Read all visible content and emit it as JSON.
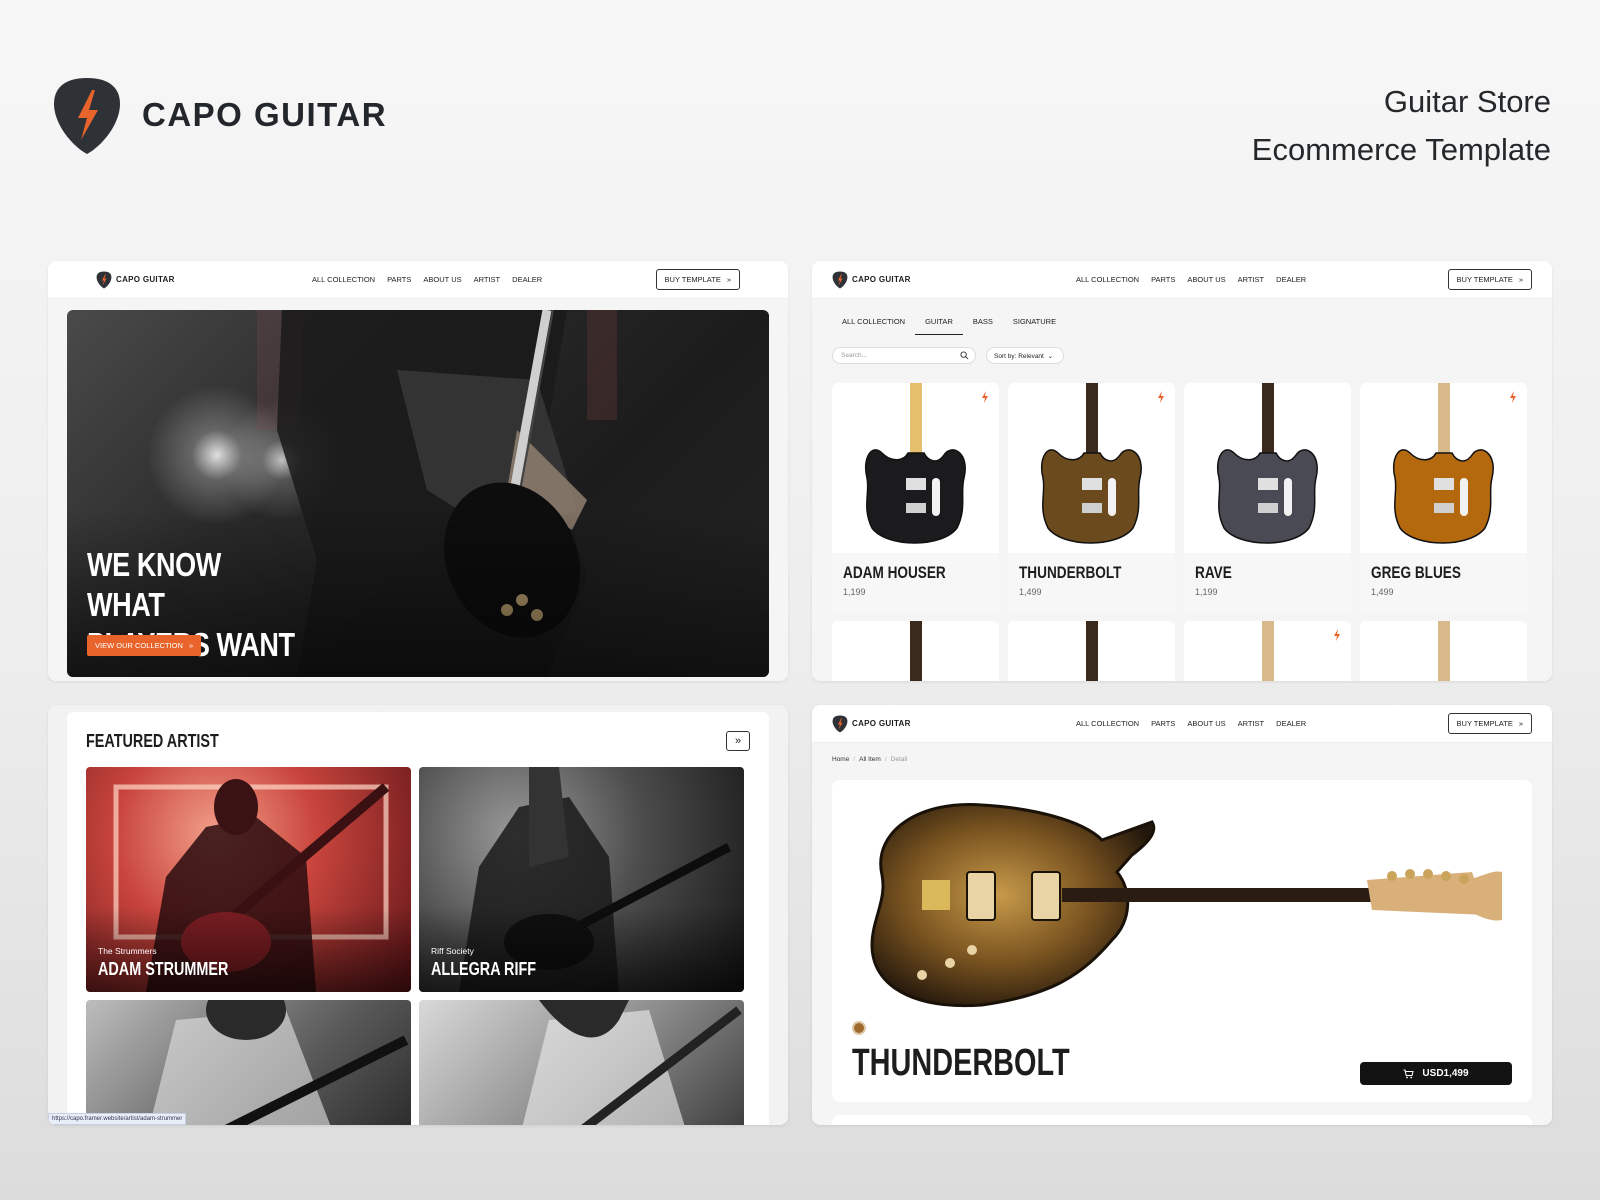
{
  "brand": {
    "name": "CAPO GUITAR",
    "tagline_1": "Guitar Store",
    "tagline_2": "Ecommerce Template"
  },
  "colors": {
    "accent": "#e8642b",
    "dark": "#2e3237",
    "text": "#1d1d1d"
  },
  "nav": {
    "brand": "CAPO GUITAR",
    "links": [
      "ALL COLLECTION",
      "PARTS",
      "ABOUT US",
      "ARTIST",
      "DEALER"
    ],
    "buy_label": "BUY TEMPLATE"
  },
  "hero": {
    "title": "WE KNOW WHAT\nPLAYERS WANT",
    "cta": "VIEW OUR COLLECTION"
  },
  "collection": {
    "tabs": [
      "ALL COLLECTION",
      "GUITAR",
      "BASS",
      "SIGNATURE"
    ],
    "active_tab": "GUITAR",
    "search_placeholder": "Search...",
    "sort_label": "Sort by: Relevant",
    "products": [
      {
        "name": "ADAM HOUSER",
        "price": "1,199",
        "featured": true,
        "body": "#1b1b1e",
        "neck": "#e5c16d"
      },
      {
        "name": "THUNDERBOLT",
        "price": "1,499",
        "featured": true,
        "body": "#6b4b1e",
        "neck": "#3a2a1e"
      },
      {
        "name": "RAVE",
        "price": "1,199",
        "featured": false,
        "body": "#4a4a55",
        "neck": "#3a2a1e"
      },
      {
        "name": "GREG BLUES",
        "price": "1,499",
        "featured": true,
        "body": "#b5690f",
        "neck": "#d8ba8a"
      }
    ],
    "second_row": [
      {
        "featured": false,
        "body": "#3a4028",
        "neck": "#3a2a1e"
      },
      {
        "featured": false,
        "body": "#b51f25",
        "neck": "#3a2a1e"
      },
      {
        "featured": true,
        "body": "#6fa8a8",
        "neck": "#d8ba8a"
      },
      {
        "featured": false,
        "body": "#5b8ca8",
        "neck": "#d8ba8a"
      }
    ]
  },
  "featured": {
    "title": "FEATURED ARTIST",
    "artists": [
      {
        "band": "The Strummers",
        "name": "ADAM STRUMMER"
      },
      {
        "band": "Riff Society",
        "name": "ALLEGRA RIFF"
      }
    ],
    "status_url": "https://capo.framer.website/artist/adam-strummer"
  },
  "detail": {
    "breadcrumb": [
      "Home",
      "All Item",
      "Detail"
    ],
    "name": "THUNDERBOLT",
    "price": "USD1,499"
  }
}
